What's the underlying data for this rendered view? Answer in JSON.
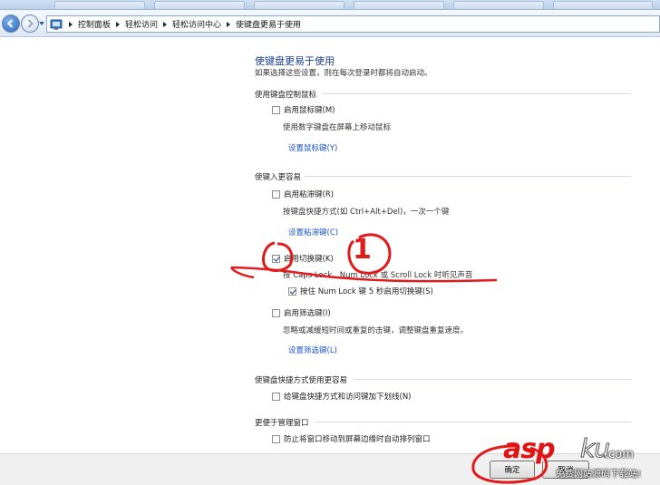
{
  "breadcrumb": {
    "items": [
      "控制面板",
      "轻松访问",
      "轻松访问中心",
      "使键盘更易于使用"
    ]
  },
  "page": {
    "title": "使键盘更易于使用",
    "subtitle": "如果选择这些设置，则在每次登录时都将自动启动。"
  },
  "sections": {
    "mouse": {
      "heading": "使用键盘控制鼠标",
      "mousekeys": {
        "label": "启用鼠标键(M)",
        "checked": false,
        "desc": "使用数字键盘在屏幕上移动鼠标",
        "link": "设置鼠标键(Y)"
      }
    },
    "typing": {
      "heading": "使键入更容易",
      "sticky": {
        "label": "启用粘滞键(R)",
        "checked": false,
        "desc": "按键盘快捷方式(如 Ctrl+Alt+Del)，一次一个键",
        "link": "设置粘滞键(C)"
      },
      "toggle": {
        "label": "启用切换键(K)",
        "checked": true,
        "desc": "按 Caps Lock、Num Lock 或 Scroll Lock 时听见声音"
      },
      "toggle_sub": {
        "label": "按住 Num Lock 键 5 秒启用切换键(S)",
        "checked": true
      },
      "filter": {
        "label": "启用筛选键(I)",
        "checked": false,
        "desc": "忽略或减缓短时间或重复的击键，调整键盘重复速度。",
        "link": "设置筛选键(L)"
      }
    },
    "shortcuts": {
      "heading": "使键盘快捷方式使用更容易",
      "underline": {
        "label": "给键盘快捷方式和访问键加下划线(N)",
        "checked": false
      }
    },
    "windows": {
      "heading": "更便于管理窗口",
      "snap": {
        "label": "防止将窗口移动到屏幕边缘时自动排列窗口",
        "checked": false
      }
    }
  },
  "buttons": {
    "ok": "确定",
    "cancel": "取消"
  },
  "annotation": {
    "number": "1",
    "color": "#e11b1b"
  },
  "watermark": {
    "brand_red": "asp",
    "brand_white": "ku",
    "tld": ".com",
    "tagline": "免费网站源码下载站!"
  },
  "colors": {
    "link": "#1b54c7",
    "title": "#1a3f8f",
    "annotation": "#e11b1b"
  }
}
